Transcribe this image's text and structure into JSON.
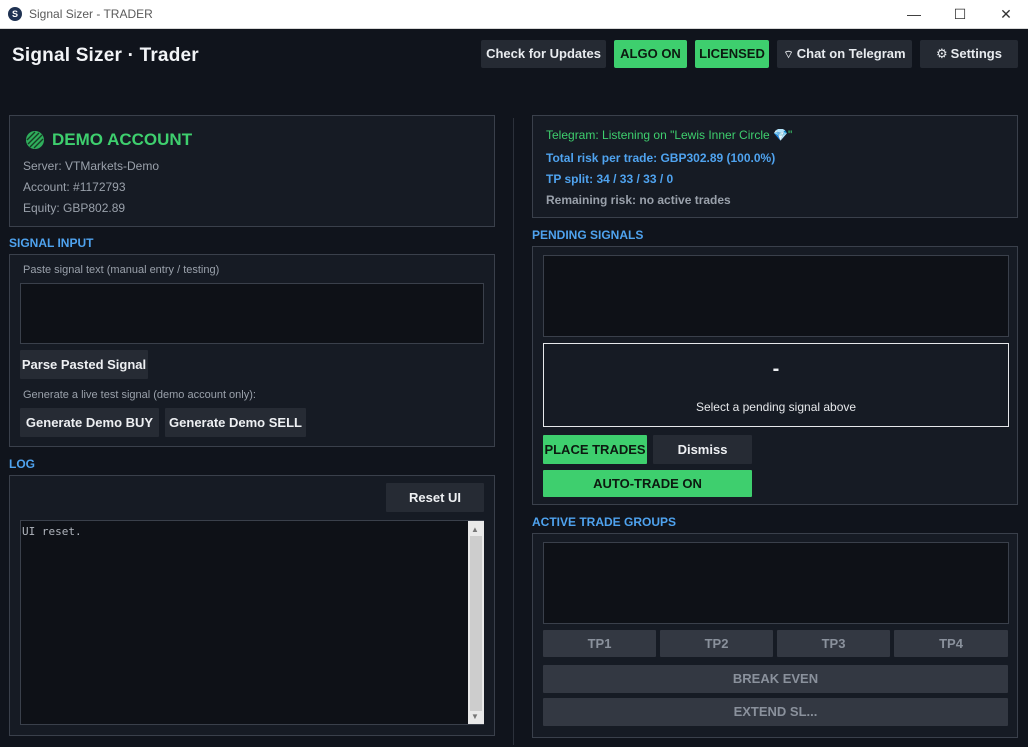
{
  "window": {
    "title": "Signal Sizer - TRADER",
    "minimize": "—",
    "maximize": "☐",
    "close": "✕"
  },
  "header": {
    "title": "Signal Sizer · Trader",
    "check_updates": "Check for Updates",
    "algo": "ALGO ON",
    "licensed": "LICENSED",
    "telegram_icon": "⌔",
    "chat": "Chat on Telegram",
    "settings_icon": "⚙",
    "settings": "Settings"
  },
  "account": {
    "type": "DEMO ACCOUNT",
    "server": "Server: VTMarkets-Demo",
    "account": "Account: #1172793",
    "equity": "Equity: GBP802.89"
  },
  "signal_input": {
    "label": "SIGNAL INPUT",
    "paste_label": "Paste signal text (manual entry / testing)",
    "textarea_value": "",
    "parse_button": "Parse Pasted Signal",
    "generate_label": "Generate a live test signal (demo account only):",
    "buy_button": "Generate Demo BUY",
    "sell_button": "Generate Demo SELL"
  },
  "log": {
    "label": "LOG",
    "reset_button": "Reset UI",
    "text": "UI reset."
  },
  "status": {
    "telegram": "Telegram: Listening on \"Lewis Inner Circle 💎\"",
    "risk": "Total risk per trade: GBP302.89 (100.0%)",
    "tp_split": "TP split: 34 / 33 / 33 / 0",
    "remaining": "Remaining risk: no active trades"
  },
  "pending": {
    "label": "PENDING SIGNALS",
    "detail_dash": "-",
    "detail_hint": "Select a pending signal above",
    "place_button": "PLACE TRADES",
    "dismiss_button": "Dismiss",
    "auto_button": "AUTO-TRADE ON"
  },
  "active": {
    "label": "ACTIVE TRADE GROUPS",
    "tp1": "TP1",
    "tp2": "TP2",
    "tp3": "TP3",
    "tp4": "TP4",
    "break_even": "BREAK EVEN",
    "extend_sl": "EXTEND SL..."
  },
  "colors": {
    "accent_blue": "#4fa3ef",
    "accent_green": "#3ecf6e",
    "background": "#10141c"
  }
}
